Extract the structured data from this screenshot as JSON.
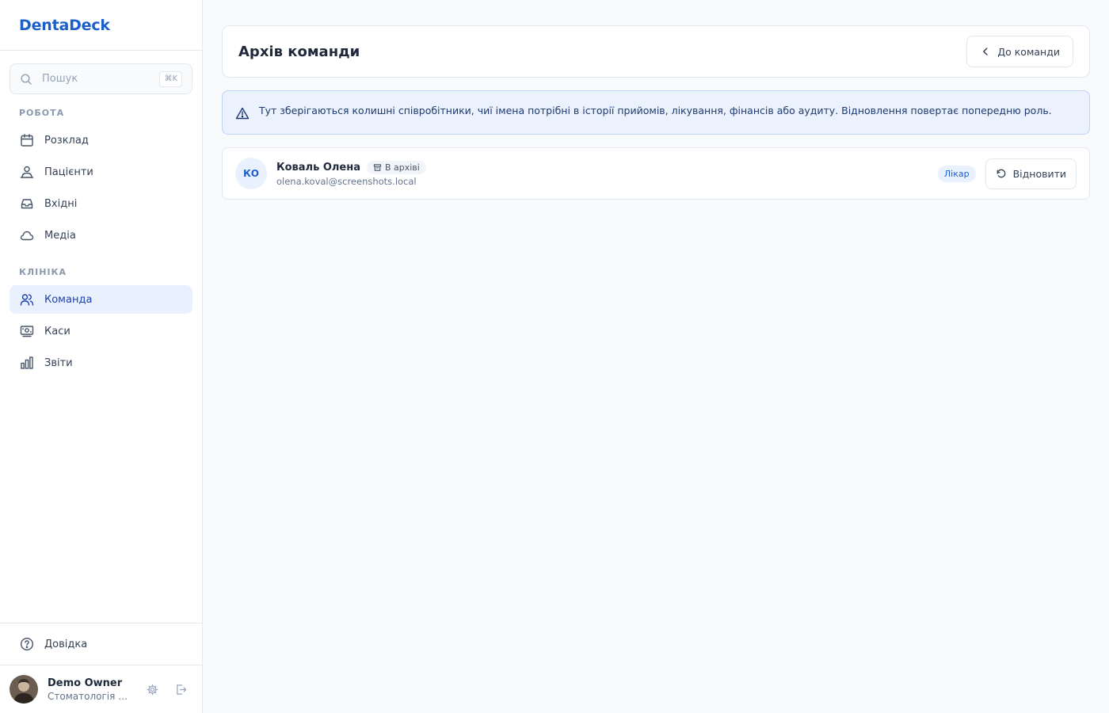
{
  "brand": {
    "name": "DentaDeck"
  },
  "search": {
    "placeholder": "Пошук",
    "shortcut": "⌘K"
  },
  "nav": {
    "work_label": "РОБОТА",
    "work_items": [
      {
        "label": "Розклад",
        "icon": "calendar-icon"
      },
      {
        "label": "Пацієнти",
        "icon": "patients-icon"
      },
      {
        "label": "Вхідні",
        "icon": "inbox-icon"
      },
      {
        "label": "Медіа",
        "icon": "cloud-icon"
      }
    ],
    "clinic_label": "КЛІНІКА",
    "clinic_items": [
      {
        "label": "Команда",
        "icon": "team-icon",
        "active": true
      },
      {
        "label": "Каси",
        "icon": "cash-register-icon"
      },
      {
        "label": "Звіти",
        "icon": "bar-chart-icon"
      }
    ],
    "help_label": "Довідка"
  },
  "user": {
    "name": "Demo Owner",
    "org": "Стоматологія П..."
  },
  "header": {
    "title": "Архів команди",
    "back_button": "До команди"
  },
  "alert": {
    "text": "Тут зберігаються колишні співробітники, чиї імена потрібні в історії прийомів, лікування, фінансів або аудиту. Відновлення повертає попередню роль."
  },
  "members": [
    {
      "initials": "КО",
      "name": "Коваль Олена",
      "status": "В архіві",
      "email": "olena.koval@screenshots.local",
      "role": "Лікар",
      "restore_label": "Відновити"
    }
  ],
  "colors": {
    "accent": "#1d5fc9",
    "active_bg": "#eaf1fe",
    "alert_bg": "#ebf2fe"
  }
}
